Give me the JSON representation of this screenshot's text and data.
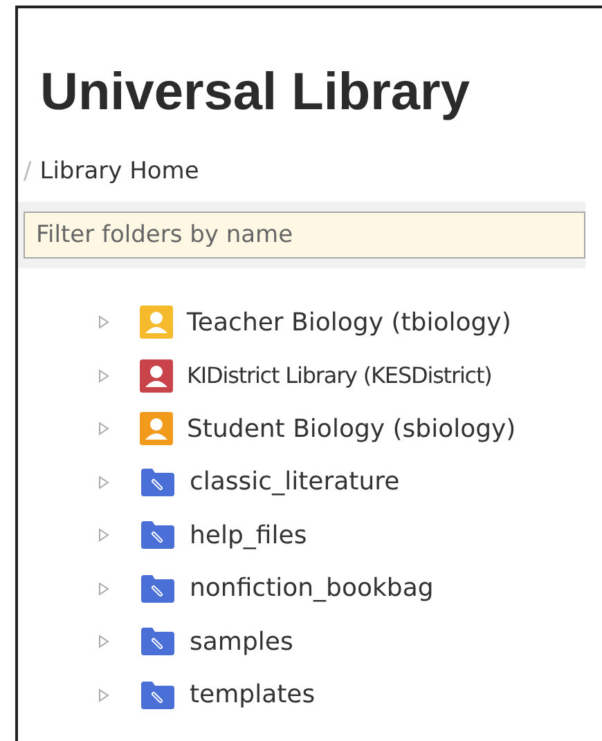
{
  "title": "Universal Library",
  "breadcrumb": {
    "separator": "/",
    "label": "Library Home"
  },
  "filter": {
    "placeholder": "Filter folders by name"
  },
  "folders": [
    {
      "kind": "user",
      "label": "Teacher Biology (tbiology)",
      "color": "#f5bb2c"
    },
    {
      "kind": "user",
      "label": "KIDistrict Library (KESDistrict)",
      "color": "#c9434a"
    },
    {
      "kind": "user",
      "label": "Student Biology (sbiology)",
      "color": "#f29a1c"
    },
    {
      "kind": "folder",
      "label": "classic_literature"
    },
    {
      "kind": "folder",
      "label": "help_files"
    },
    {
      "kind": "folder",
      "label": "nonfiction_bookbag"
    },
    {
      "kind": "folder",
      "label": "samples"
    },
    {
      "kind": "folder",
      "label": "templates"
    }
  ]
}
